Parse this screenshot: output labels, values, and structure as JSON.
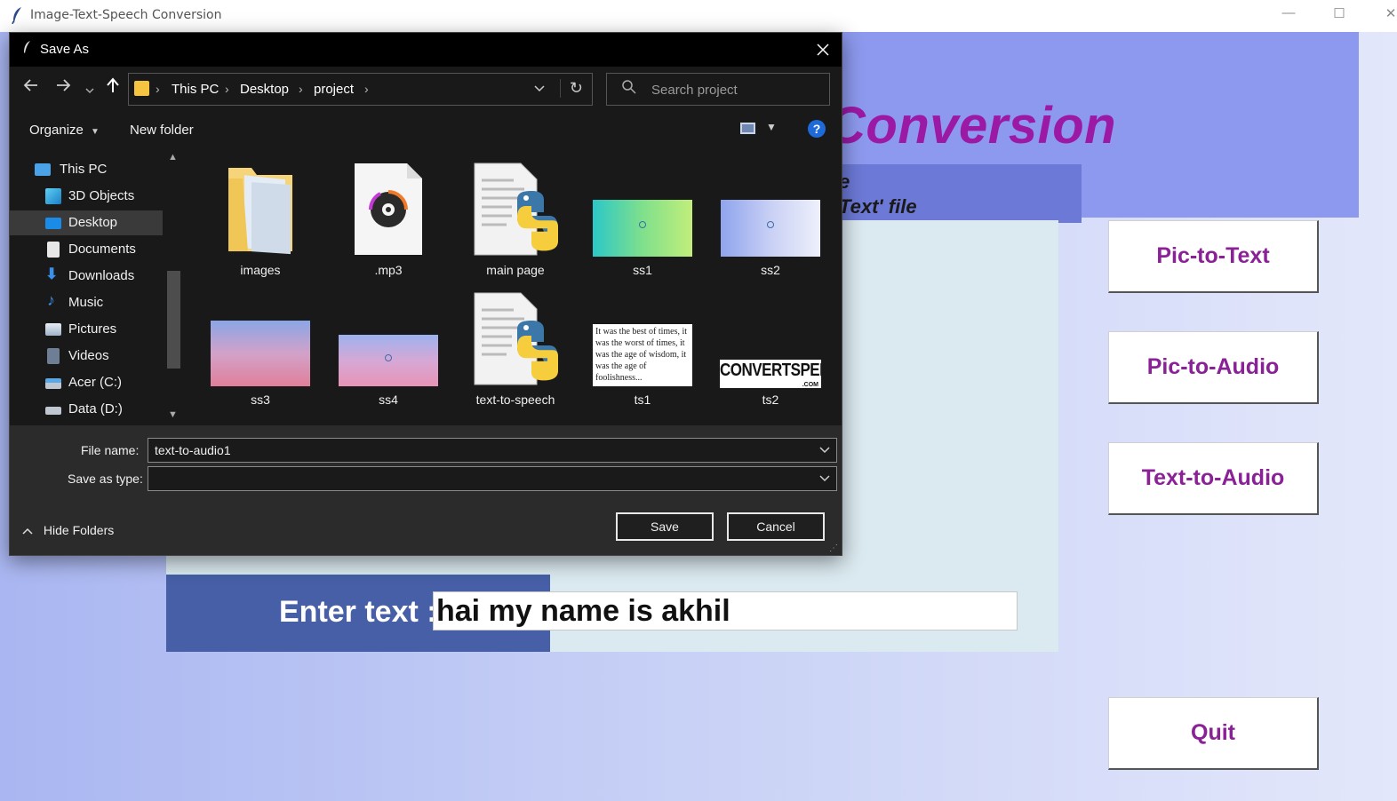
{
  "window": {
    "title": "Image-Text-Speech Conversion",
    "app_icon": "feather-icon",
    "minimize": "—",
    "maximize": "☐",
    "close": "✕"
  },
  "app": {
    "header_title": "Conversion",
    "subtitle_line1": "e",
    "subtitle_line2": "Text' file",
    "enter_label": "Enter text :",
    "text_value": "hai my name is akhil",
    "buttons": {
      "pic_to_text": "Pic-to-Text",
      "pic_to_audio": "Pic-to-Audio",
      "text_to_audio": "Text-to-Audio",
      "quit": "Quit"
    },
    "colors": {
      "header_band": "#8d99ee",
      "title": "#9b19a5",
      "button_text": "#8a2196",
      "enter_band": "#465fa6"
    }
  },
  "dialog": {
    "title": "Save As",
    "breadcrumb": [
      "This PC",
      "Desktop",
      "project"
    ],
    "search_placeholder": "Search project",
    "organize": "Organize",
    "new_folder": "New folder",
    "help": "?",
    "nav_items": [
      {
        "label": "This PC",
        "icon": "computer-icon"
      },
      {
        "label": "3D Objects",
        "icon": "cube-icon"
      },
      {
        "label": "Desktop",
        "icon": "desktop-icon",
        "selected": true
      },
      {
        "label": "Documents",
        "icon": "document-icon"
      },
      {
        "label": "Downloads",
        "icon": "download-icon"
      },
      {
        "label": "Music",
        "icon": "music-icon"
      },
      {
        "label": "Pictures",
        "icon": "pictures-icon"
      },
      {
        "label": "Videos",
        "icon": "videos-icon"
      },
      {
        "label": "Acer (C:)",
        "icon": "drive-icon"
      },
      {
        "label": "Data (D:)",
        "icon": "drive-icon"
      }
    ],
    "files": [
      {
        "name": "images",
        "kind": "folder"
      },
      {
        "name": ".mp3",
        "kind": "audio"
      },
      {
        "name": "main page",
        "kind": "python"
      },
      {
        "name": "ss1",
        "kind": "image-green"
      },
      {
        "name": "ss2",
        "kind": "image-blue"
      },
      {
        "name": "ss3",
        "kind": "image-pink"
      },
      {
        "name": "ss4",
        "kind": "image-purple"
      },
      {
        "name": "text-to-speech",
        "kind": "python"
      },
      {
        "name": "ts1",
        "kind": "image-text"
      },
      {
        "name": "ts2",
        "kind": "image-logo"
      }
    ],
    "ts1_preview_text": "It was the best of times, it was the worst of times, it was the age of wisdom, it was the age of foolishness...",
    "ts2_logo_text": "CONVERTSPEECH",
    "ts2_logo_sub": ".COM",
    "file_name_label": "File name:",
    "file_name_value": "text-to-audio1",
    "save_type_label": "Save as type:",
    "save_type_value": "",
    "hide_folders": "Hide Folders",
    "save_button": "Save",
    "cancel_button": "Cancel"
  }
}
